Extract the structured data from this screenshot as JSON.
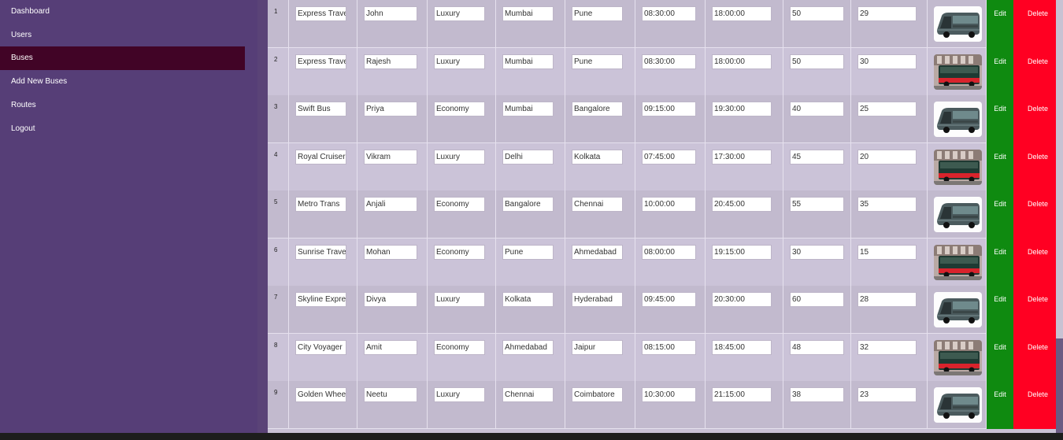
{
  "sidebar": {
    "items": [
      {
        "label": "Dashboard"
      },
      {
        "label": "Users"
      },
      {
        "label": "Buses",
        "active": true
      },
      {
        "label": "Add New Buses"
      },
      {
        "label": "Routes"
      },
      {
        "label": "Logout"
      }
    ]
  },
  "table": {
    "rows": [
      {
        "id": "1",
        "bus_name": "Express Trave",
        "driver": "John",
        "type": "Luxury",
        "from": "Mumbai",
        "to": "Pune",
        "departure": "08:30:00",
        "arrival": "18:00:00",
        "capacity": "50",
        "available": "29",
        "image": "bus-dark",
        "edit": "Edit",
        "delete": "Delete"
      },
      {
        "id": "2",
        "bus_name": "Express Trave",
        "driver": "Rajesh",
        "type": "Luxury",
        "from": "Mumbai",
        "to": "Pune",
        "departure": "08:30:00",
        "arrival": "18:00:00",
        "capacity": "50",
        "available": "30",
        "image": "bus-city",
        "edit": "Edit",
        "delete": "Delete"
      },
      {
        "id": "3",
        "bus_name": "Swift Bus",
        "driver": "Priya",
        "type": "Economy",
        "from": "Mumbai",
        "to": "Bangalore",
        "departure": "09:15:00",
        "arrival": "19:30:00",
        "capacity": "40",
        "available": "25",
        "image": "bus-dark",
        "edit": "Edit",
        "delete": "Delete"
      },
      {
        "id": "4",
        "bus_name": "Royal Cruiser",
        "driver": "Vikram",
        "type": "Luxury",
        "from": "Delhi",
        "to": "Kolkata",
        "departure": "07:45:00",
        "arrival": "17:30:00",
        "capacity": "45",
        "available": "20",
        "image": "bus-city",
        "edit": "Edit",
        "delete": "Delete"
      },
      {
        "id": "5",
        "bus_name": "Metro Trans",
        "driver": "Anjali",
        "type": "Economy",
        "from": "Bangalore",
        "to": "Chennai",
        "departure": "10:00:00",
        "arrival": "20:45:00",
        "capacity": "55",
        "available": "35",
        "image": "bus-dark",
        "edit": "Edit",
        "delete": "Delete"
      },
      {
        "id": "6",
        "bus_name": "Sunrise Travel",
        "driver": "Mohan",
        "type": "Economy",
        "from": "Pune",
        "to": "Ahmedabad",
        "departure": "08:00:00",
        "arrival": "19:15:00",
        "capacity": "30",
        "available": "15",
        "image": "bus-city",
        "edit": "Edit",
        "delete": "Delete"
      },
      {
        "id": "7",
        "bus_name": "Skyline Expres",
        "driver": "Divya",
        "type": "Luxury",
        "from": "Kolkata",
        "to": "Hyderabad",
        "departure": "09:45:00",
        "arrival": "20:30:00",
        "capacity": "60",
        "available": "28",
        "image": "bus-dark",
        "edit": "Edit",
        "delete": "Delete"
      },
      {
        "id": "8",
        "bus_name": "City Voyager",
        "driver": "Amit",
        "type": "Economy",
        "from": "Ahmedabad",
        "to": "Jaipur",
        "departure": "08:15:00",
        "arrival": "18:45:00",
        "capacity": "48",
        "available": "32",
        "image": "bus-city",
        "edit": "Edit",
        "delete": "Delete"
      },
      {
        "id": "9",
        "bus_name": "Golden Whee",
        "driver": "Neetu",
        "type": "Luxury",
        "from": "Chennai",
        "to": "Coimbatore",
        "departure": "10:30:00",
        "arrival": "21:15:00",
        "capacity": "38",
        "available": "23",
        "image": "bus-dark",
        "edit": "Edit",
        "delete": "Delete"
      }
    ]
  },
  "colors": {
    "sidebar_bg": "#563e77",
    "active_nav": "#410426",
    "edit_btn": "#0f8a10",
    "delete_btn": "#ff0022"
  }
}
